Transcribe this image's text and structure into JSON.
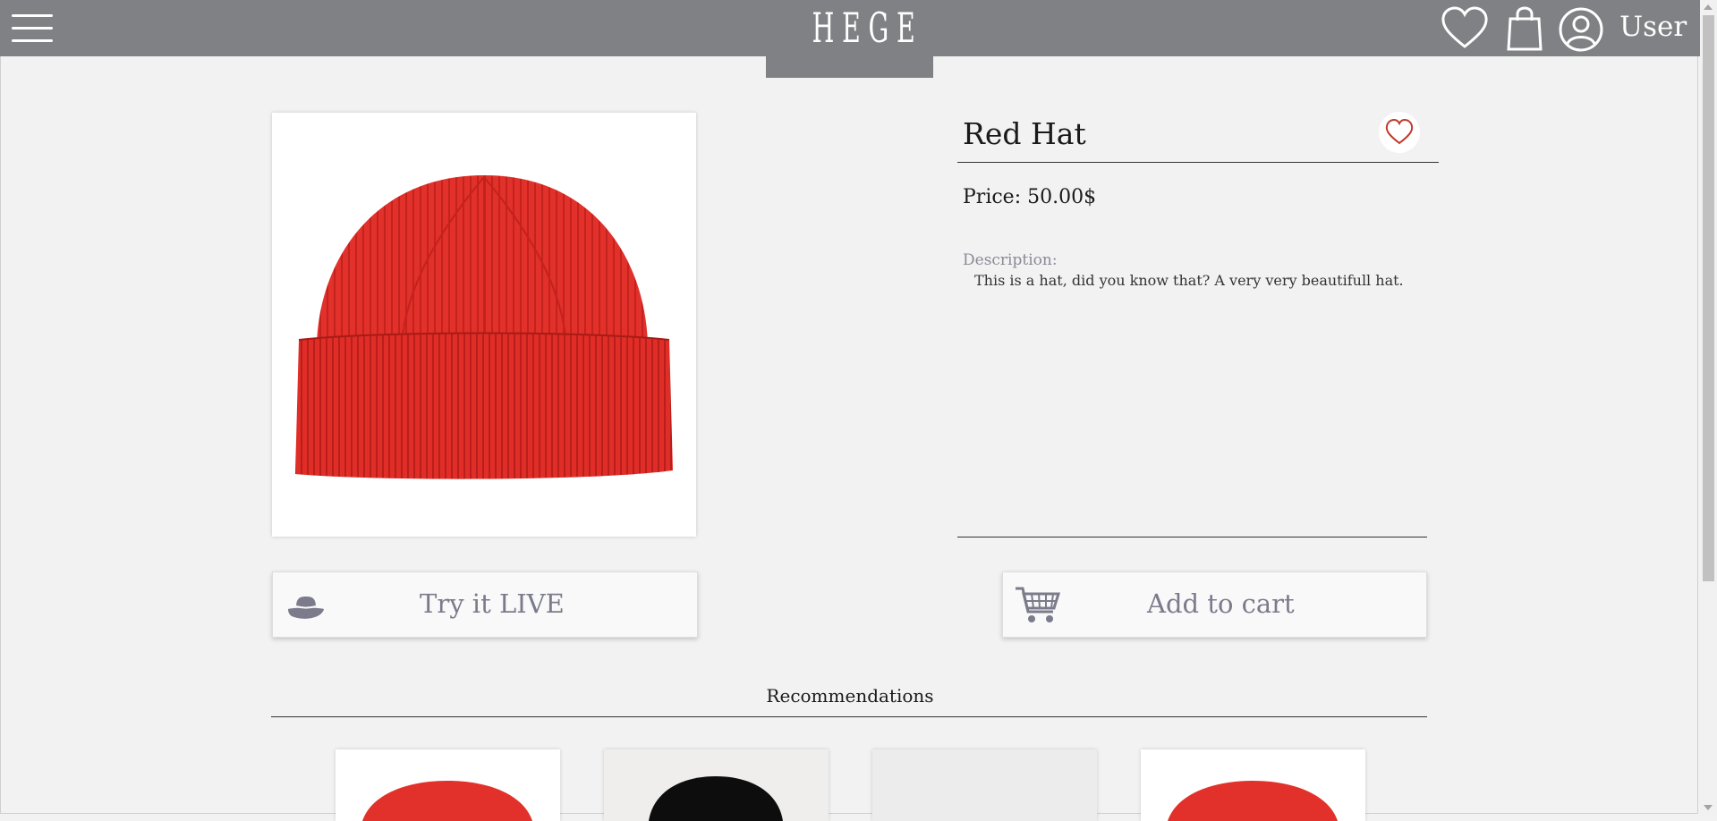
{
  "header": {
    "logo": "HEGE",
    "user_label": "User"
  },
  "product": {
    "name": "Red Hat",
    "price": "Price: 50.00$",
    "description_label": "Description:",
    "description": "This is a hat, did you know that? A very very beautifull hat.",
    "image_alt": "red-knit-beanie"
  },
  "actions": {
    "try_live": "Try it LIVE",
    "add_to_cart": "Add to cart"
  },
  "recommendations": {
    "title": "Recommendations",
    "items": [
      {
        "color": "#e2302a",
        "background": "#ffffff"
      },
      {
        "color": "#0d0d0d",
        "background": "#efeeed"
      },
      {
        "color": "#efeeed",
        "background": "#ececec"
      },
      {
        "color": "#e2302a",
        "background": "#ffffff"
      }
    ]
  },
  "colors": {
    "header": "#808184",
    "accent_heart": "#c0392b",
    "button_text": "#7b7b8c",
    "hat_red": "#e2302a"
  }
}
